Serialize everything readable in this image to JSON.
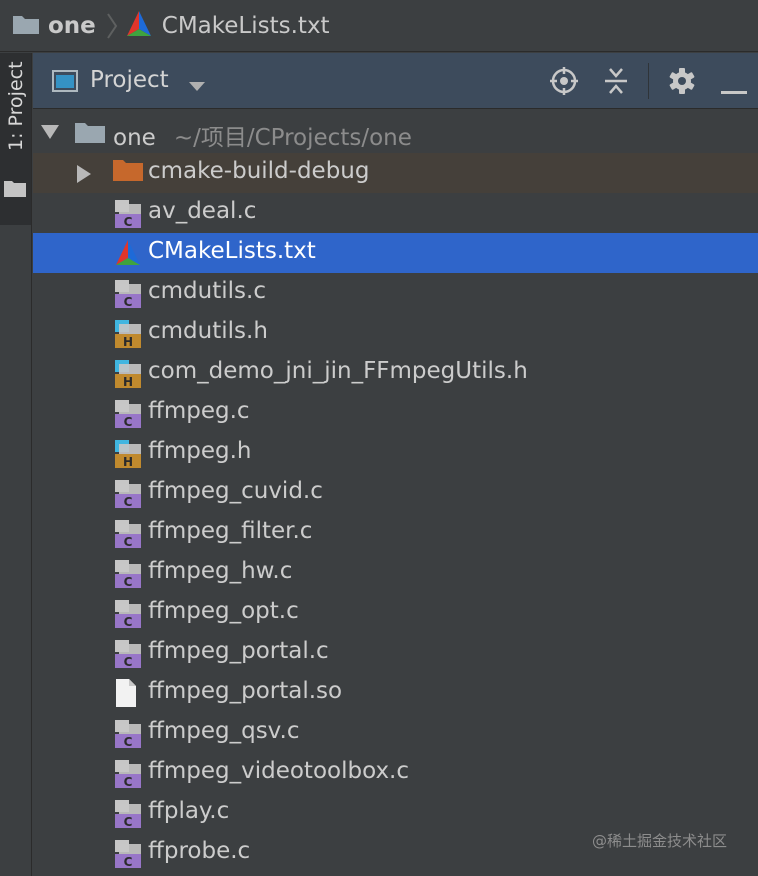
{
  "breadcrumb": {
    "project": "one",
    "file": "CMakeLists.txt"
  },
  "toolstrip": {
    "tab_label": "1: Project"
  },
  "panel": {
    "title": "Project"
  },
  "tree": {
    "root": {
      "name": "one",
      "path": "~/项目/CProjects/one"
    },
    "items": [
      {
        "name": "cmake-build-debug",
        "type": "folder"
      },
      {
        "name": "av_deal.c",
        "type": "c"
      },
      {
        "name": "CMakeLists.txt",
        "type": "cmake",
        "selected": true
      },
      {
        "name": "cmdutils.c",
        "type": "c"
      },
      {
        "name": "cmdutils.h",
        "type": "h"
      },
      {
        "name": "com_demo_jni_jin_FFmpegUtils.h",
        "type": "h"
      },
      {
        "name": "ffmpeg.c",
        "type": "c"
      },
      {
        "name": "ffmpeg.h",
        "type": "h"
      },
      {
        "name": "ffmpeg_cuvid.c",
        "type": "c"
      },
      {
        "name": "ffmpeg_filter.c",
        "type": "c"
      },
      {
        "name": "ffmpeg_hw.c",
        "type": "c"
      },
      {
        "name": "ffmpeg_opt.c",
        "type": "c"
      },
      {
        "name": "ffmpeg_portal.c",
        "type": "c"
      },
      {
        "name": "ffmpeg_portal.so",
        "type": "so"
      },
      {
        "name": "ffmpeg_qsv.c",
        "type": "c"
      },
      {
        "name": "ffmpeg_videotoolbox.c",
        "type": "c"
      },
      {
        "name": "ffplay.c",
        "type": "c"
      },
      {
        "name": "ffprobe.c",
        "type": "c"
      }
    ]
  },
  "watermark": "@稀土掘金技术社区",
  "colors": {
    "selection": "#2f65ca",
    "folder_highlight": "#45403a",
    "header": "#3d4b5c",
    "c_badge": "#9876c8",
    "h_badge": "#c08a2e",
    "file_accent": "#40b6e0",
    "excluded_folder": "#c6682c"
  }
}
